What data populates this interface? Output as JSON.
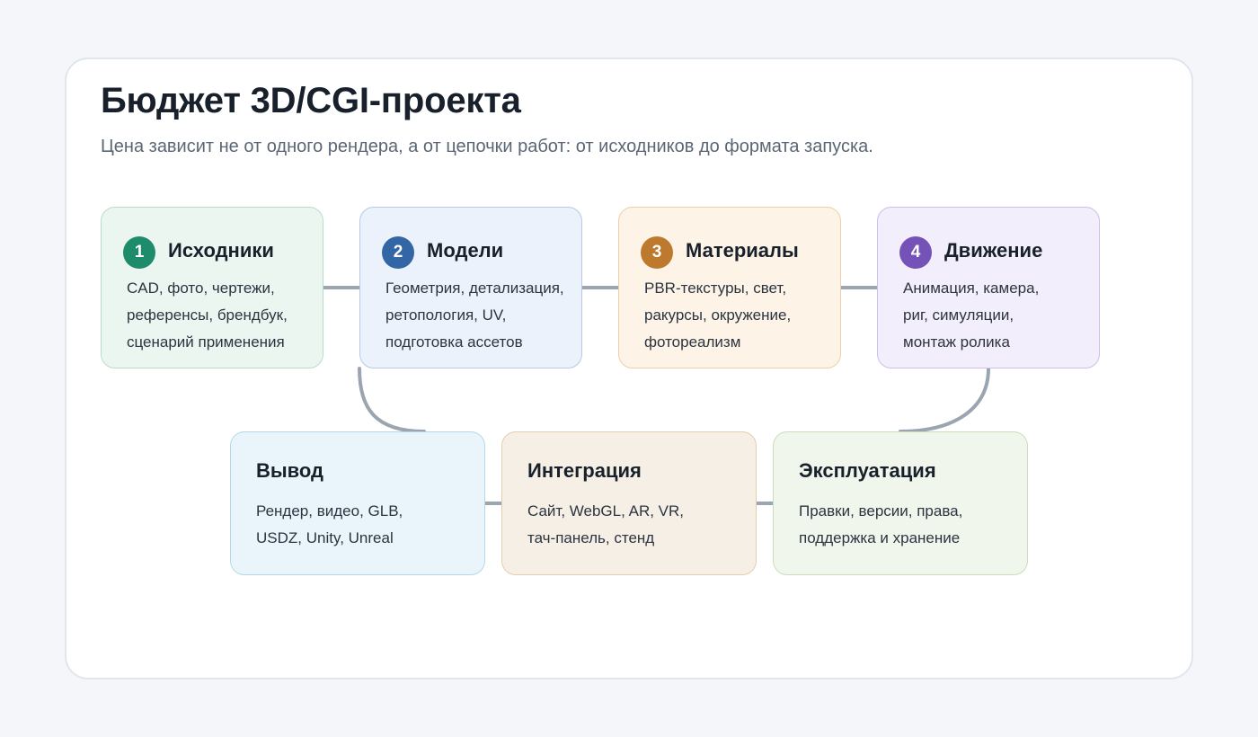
{
  "header": {
    "title": "Бюджет 3D/CGI-проекта",
    "subtitle": "Цена зависит не от одного рендера, а от цепочки работ: от исходников до формата запуска."
  },
  "steps": [
    {
      "number": "1",
      "title": "Исходники",
      "lines": [
        "CAD, фото, чертежи,",
        "референсы, брендбук,",
        "сценарий применения"
      ],
      "color": "#1e8b6b"
    },
    {
      "number": "2",
      "title": "Модели",
      "lines": [
        "Геометрия, детализация,",
        "ретопология, UV,",
        "подготовка ассетов"
      ],
      "color": "#3366a4"
    },
    {
      "number": "3",
      "title": "Материалы",
      "lines": [
        "PBR-текстуры, свет,",
        "ракурсы, окружение,",
        "фотореализм"
      ],
      "color": "#bd7a2e"
    },
    {
      "number": "4",
      "title": "Движение",
      "lines": [
        "Анимация, камера,",
        "риг, симуляции,",
        "монтаж ролика"
      ],
      "color": "#7452b8"
    }
  ],
  "outputs": [
    {
      "title": "Вывод",
      "lines": [
        "Рендер, видео, GLB,",
        "USDZ, Unity, Unreal"
      ]
    },
    {
      "title": "Интеграция",
      "lines": [
        "Сайт, WebGL, AR, VR,",
        "тач-панель, стенд"
      ]
    },
    {
      "title": "Эксплуатация",
      "lines": [
        "Правки, версии, права,",
        "поддержка и хранение"
      ]
    }
  ],
  "connector_color": "#9aa5b1"
}
